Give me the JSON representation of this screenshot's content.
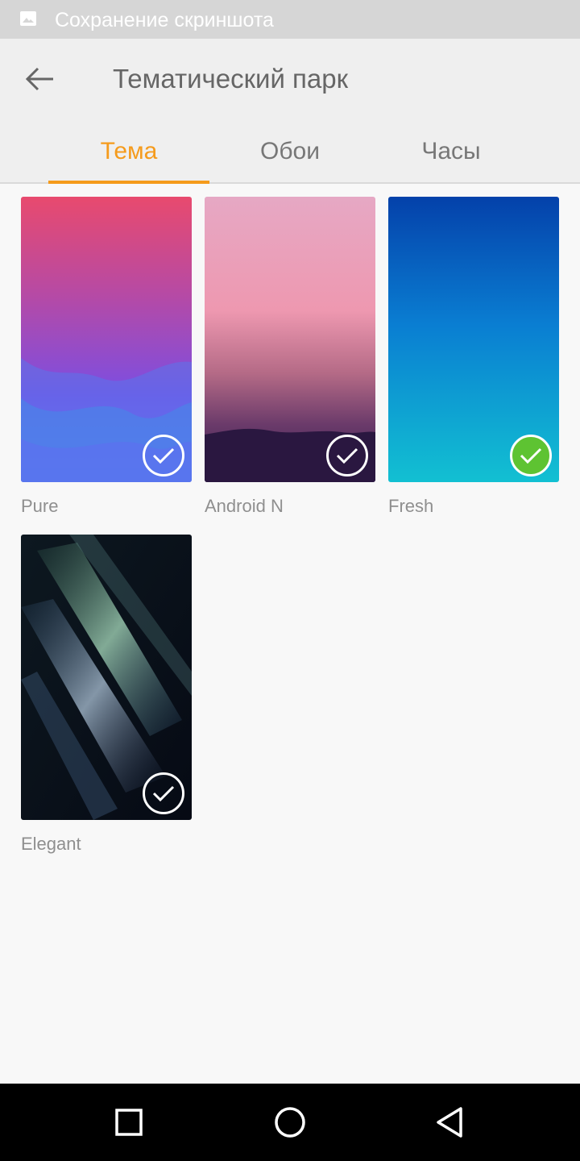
{
  "status_bar": {
    "icon": "image-icon",
    "text": "Сохранение скриншота"
  },
  "header": {
    "back_icon": "arrow-left-icon",
    "title": "Тематический парк"
  },
  "tabs": [
    {
      "label": "Тема",
      "active": true
    },
    {
      "label": "Обои",
      "active": false
    },
    {
      "label": "Часы",
      "active": false
    }
  ],
  "themes": [
    {
      "name": "Pure",
      "selected": false
    },
    {
      "name": "Android N",
      "selected": false
    },
    {
      "name": "Fresh",
      "selected": true
    },
    {
      "name": "Elegant",
      "selected": false
    }
  ],
  "nav": {
    "recents_icon": "square-icon",
    "home_icon": "circle-icon",
    "back_icon": "triangle-back-icon"
  },
  "colors": {
    "accent": "#f59b1c",
    "selected_check": "#5ec332"
  }
}
